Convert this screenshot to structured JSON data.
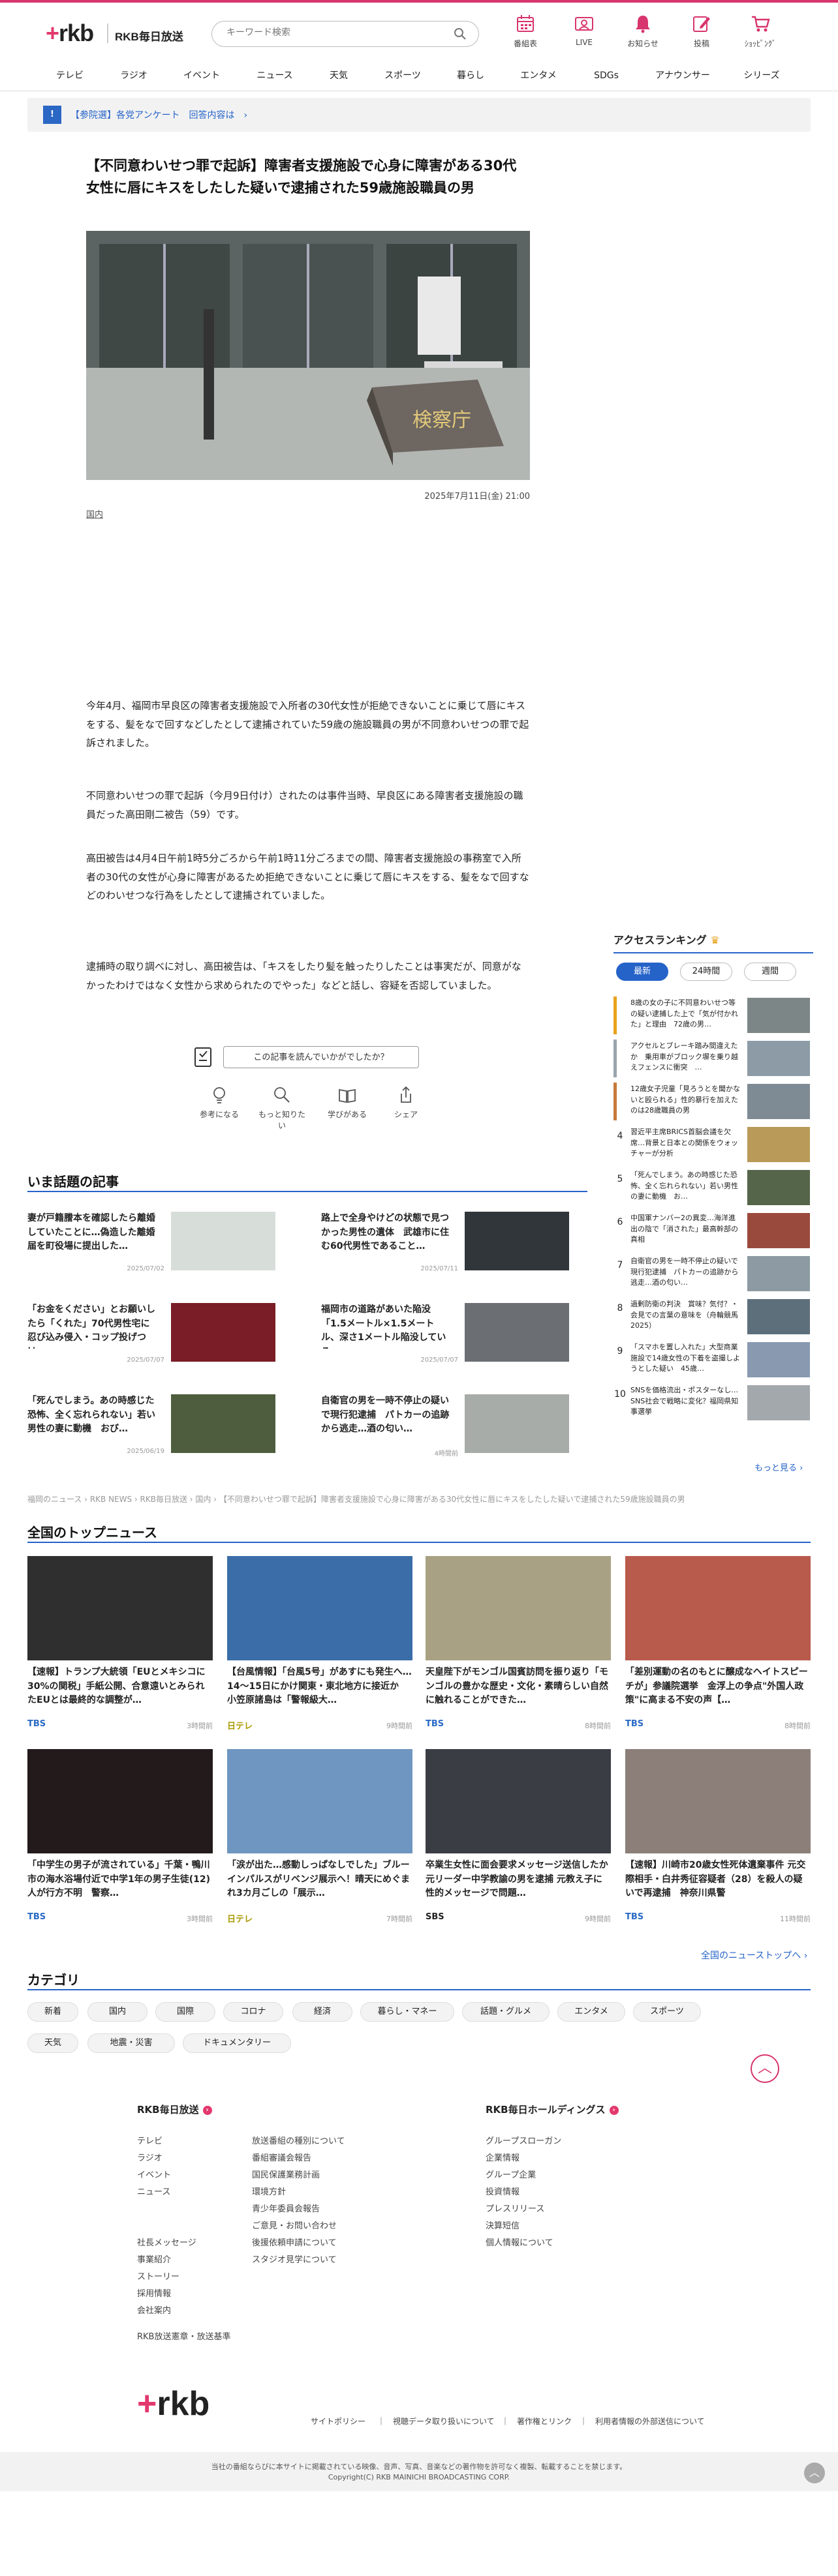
{
  "header": {
    "logo": "rkb",
    "brand": "RKB毎日放送",
    "search_placeholder": "キーワード検索",
    "nav": [
      "番組表",
      "LIVE",
      "お知らせ",
      "投稿",
      "ｼｮｯﾋﾟﾝｸﾞ"
    ]
  },
  "topnav": [
    "テレビ",
    "ラジオ",
    "イベント",
    "ニュース",
    "天気",
    "スポーツ",
    "暮らし",
    "エンタメ",
    "SDGs",
    "アナウンサー",
    "シリーズ"
  ],
  "notice": {
    "badge": "!",
    "text": "【参院選】各党アンケート　回答内容は　›"
  },
  "article": {
    "title": "【不同意わいせつ罪で起訴】障害者支援施設で心身に障害がある30代女性に唇にキスをしたした疑いで逮捕された59歳施設職員の男",
    "photo_caption": "検察庁",
    "date": "2025年7月11日(金) 21:00",
    "category": "国内",
    "paragraphs": [
      "今年4月、福岡市早良区の障害者支援施設で入所者の30代女性が拒絶できないことに乗じて唇にキスをする、髪をなで回すなどしたとして逮捕されていた59歳の施設職員の男が不同意わいせつの罪で起訴されました。",
      "不同意わいせつの罪で起訴（今月9日付け）されたのは事件当時、早良区にある障害者支援施設の職員だった高田剛二被告（59）です。",
      "高田被告は4月4日午前1時5分ごろから午前1時11分ごろまでの間、障害者支援施設の事務室で入所者の30代の女性が心身に障害があるため拒絶できないことに乗じて唇にキスをする、髪をなで回すなどのわいせつな行為をしたとして逮捕されていました。",
      "逮捕時の取り調べに対し、高田被告は、「キスをしたり髪を触ったりしたことは事実だが、同意がなかったわけではなく女性から求められたのでやった」などと話し、容疑を否認していました。"
    ],
    "feedback_question": "この記事を読んでいかがでしたか？",
    "reactions": [
      "参考になる",
      "もっと知りたい",
      "学びがある",
      "シェア"
    ]
  },
  "ranking": {
    "title": "アクセスランキング",
    "tabs": [
      "最新",
      "24時間",
      "週間"
    ],
    "items": [
      {
        "num": "1",
        "text": "8歳の女の子に不同意わいせつ等の疑い逮捕した上で「気が付かれた」と理由　72歳の男…"
      },
      {
        "num": "2",
        "text": "アクセルとブレーキ踏み間違えたか　乗用車がブロック塀を乗り越えフェンスに衝突　…"
      },
      {
        "num": "3",
        "text": "12歳女子児童「見ろうとを聞かないと殴られる」性的暴行を加えたのは28歳職員の男"
      },
      {
        "num": "4",
        "text": "習近平主席BRICS首脳会議を欠席…背景と日本との関係をウォッチャーが分析"
      },
      {
        "num": "5",
        "text": "「死んでしまう。あの時感じた恐怖、全く忘れられない」若い男性の妻に動機　お… "
      },
      {
        "num": "6",
        "text": "中国軍ナンバー2の異変…海洋進出の陰で「消された」最高幹部の真相"
      },
      {
        "num": "7",
        "text": "自衛官の男を一時不停止の疑いで現行犯逮捕　パトカーの追跡から逃走…酒の匂い…"
      },
      {
        "num": "8",
        "text": "過剰防衛の判決　賞味？気付？・会見での言葉の意味を（舟輪競馬2025）"
      },
      {
        "num": "9",
        "text": "「スマホを置し入れた」大型商業施設で14歳女性の下着を盗撮しようとした疑い　45歳…"
      },
      {
        "num": "10",
        "text": "SNSを価格流出・ポスターなし…SNS社会で戦略に変化？福岡県知事選挙"
      }
    ],
    "more": "もっと見る ›"
  },
  "hot": {
    "title": "いま話題の記事",
    "items": [
      {
        "title": "妻が戸籍謄本を確認したら離婚していたことに…偽造した離婚届を町役場に提出した…",
        "date": "2025/07/02"
      },
      {
        "title": "路上で全身やけどの状態で見つかった男性の遺体　武雄市に住む60代男性であること…",
        "date": "2025/07/11"
      },
      {
        "title": "「お金をください」とお願いしたら「くれた」70代男性宅に忍び込み侵入・コップ投げつけ…",
        "date": "2025/07/07"
      },
      {
        "title": "福岡市の道路があいた陥没「1.5メートル×1.5メートル、深さ1メートル陥没している」…",
        "date": "2025/07/07"
      },
      {
        "title": "「死んでしまう。あの時感じた恐怖、全く忘れられない」若い男性の妻に動機　おび…",
        "date": "2025/06/19"
      },
      {
        "title": "自衛官の男を一時不停止の疑いで現行犯逮捕　パトカーの追跡から逃走…酒の匂い…",
        "date": "4時間前"
      }
    ]
  },
  "breadcrumb": "福岡のニュース › RKB NEWS › RKB毎日放送 › 国内 › 【不同意わいせつ罪で起訴】障害者支援施設で心身に障害がある30代女性に唇にキスをしたした疑いで逮捕された59歳施設職員の男",
  "national": {
    "title": "全国のトップニュース",
    "items": [
      {
        "title": "【速報】トランプ大統領「EUとメキシコに30%の関税」手紙公開、合意遠いとみられたEUとは最終的な調整が…",
        "src": "TBS",
        "time": "3時間前"
      },
      {
        "title": "【台風情報】「台風5号」があすにも発生へ…14〜15日にかけ関東・東北地方に接近か　小笠原諸島は「警報級大…",
        "src": "日テレ",
        "time": "9時間前"
      },
      {
        "title": "天皇陛下がモンゴル国賓訪問を振り返り「モンゴルの豊かな歴史・文化・素晴らしい自然に触れることができた…",
        "src": "TBS",
        "time": "8時間前"
      },
      {
        "title": "「差別運動の名のもとに醸成なヘイトスピーチが」参議院選挙　金浮上の争点\"外国人政策\"に高まる不安の声【…",
        "src": "TBS",
        "time": "8時間前"
      },
      {
        "title": "「中学生の男子が流されている」千葉・鴨川市の海水浴場付近で中学1年の男子生徒(12)人が行方不明　警察…",
        "src": "TBS",
        "time": "3時間前"
      },
      {
        "title": "「涙が出た…感動しっぱなしでした」ブルーインパルスがリベンジ展示へ！晴天にめぐまれ3カ月ごしの「展示…",
        "src": "日テレ",
        "time": "7時間前"
      },
      {
        "title": "卒業生女性に面会要求メッセージ送信したか 元リーダー中学教諭の男を逮捕 元教え子に性的メッセージで問題…",
        "src": "SBS",
        "time": "9時間前"
      },
      {
        "title": "【速報】川崎市20歳女性死体遺棄事件 元交際相手・白井秀征容疑者（28）を殺人の疑いで再逮捕　神奈川県警",
        "src": "TBS",
        "time": "11時間前"
      }
    ],
    "all_link": "全国のニューストップへ ›"
  },
  "categories": {
    "title": "カテゴリ",
    "chips": [
      "新着",
      "国内",
      "国際",
      "コロナ",
      "経済",
      "暮らし・マネー",
      "話題・グルメ",
      "エンタメ",
      "スポーツ",
      "天気",
      "地震・災害",
      "ドキュメンタリー"
    ]
  },
  "footer": {
    "col1_title": "RKB毎日放送",
    "col1a": [
      "テレビ",
      "ラジオ",
      "イベント",
      "ニュース",
      "",
      "",
      "社長メッセージ",
      "事業紹介",
      "ストーリー",
      "採用情報",
      "会社案内",
      "RKB放送憲章・放送基準"
    ],
    "col1b": [
      "放送番組の種別について",
      "番組審議会報告",
      "国民保護業務計画",
      "環境方針",
      "青少年委員会報告",
      "ご意見・お問い合わせ",
      "後援依頼申請について",
      "スタジオ見学について"
    ],
    "col2_title": "RKB毎日ホールディングス",
    "col2": [
      "グループスローガン",
      "企業情報",
      "グループ企業",
      "投資情報",
      "プレスリリース",
      "決算短信",
      "個人情報について"
    ],
    "bottom_links": [
      "サイトポリシー",
      "｜　視聴データ取り扱いについて",
      "｜　著作権とリンク",
      "｜　利用者情報の外部送信について"
    ],
    "copy1": "当社の番組ならびに本サイトに掲載されている映像、音声、写真、音楽などの著作物を許可なく複製、転載することを禁じます。",
    "copy2": "Copyright(C) RKB MAINICHI BROADCASTING CORP."
  }
}
